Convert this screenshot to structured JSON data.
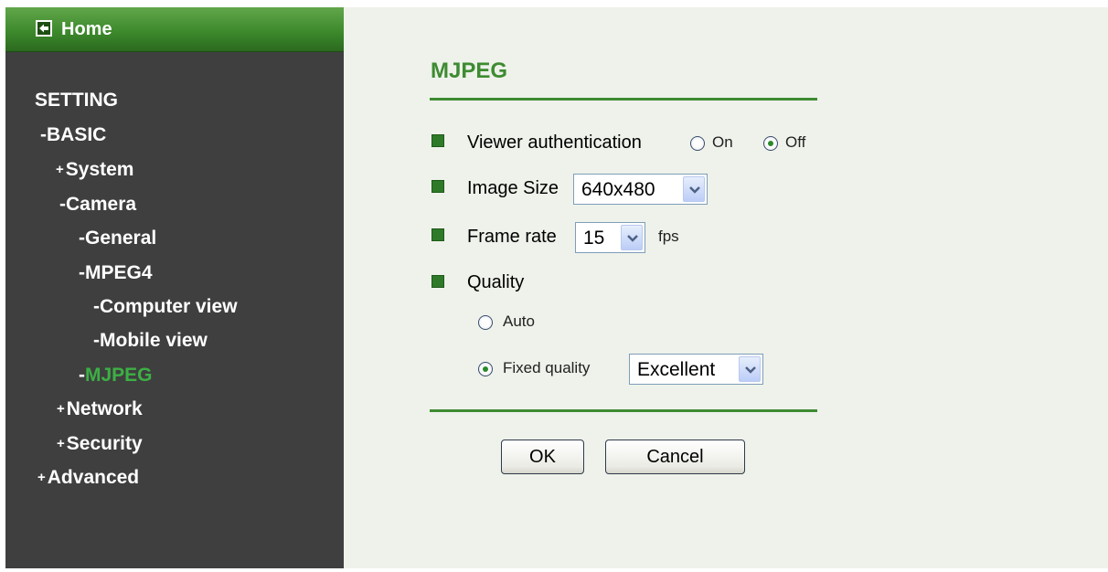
{
  "sidebar": {
    "home_label": "Home",
    "setting_label": "SETTING",
    "items": [
      {
        "prefix": "-",
        "label": "BASIC"
      },
      {
        "prefix": "+",
        "label": "System"
      },
      {
        "prefix": "-",
        "label": "Camera"
      },
      {
        "prefix": "-",
        "label": "General"
      },
      {
        "prefix": "-",
        "label": "MPEG4"
      },
      {
        "prefix": "-",
        "label": "Computer view"
      },
      {
        "prefix": "-",
        "label": "Mobile view"
      },
      {
        "prefix": "-",
        "label": "MJPEG"
      },
      {
        "prefix": "+",
        "label": "Network"
      },
      {
        "prefix": "+",
        "label": "Security"
      },
      {
        "prefix": "+",
        "label": "Advanced"
      }
    ],
    "active_item": "MJPEG"
  },
  "main": {
    "title": "MJPEG",
    "viewer_auth": {
      "label": "Viewer authentication",
      "options": [
        "On",
        "Off"
      ],
      "selected": "Off"
    },
    "image_size": {
      "label": "Image Size",
      "value": "640x480"
    },
    "frame_rate": {
      "label": "Frame rate",
      "value": "15",
      "unit": "fps"
    },
    "quality": {
      "label": "Quality",
      "auto_label": "Auto",
      "fixed_label": "Fixed quality",
      "fixed_value": "Excellent",
      "selected": "Fixed quality"
    },
    "buttons": {
      "ok": "OK",
      "cancel": "Cancel"
    }
  },
  "colors": {
    "sidebar_bg": "#3f3f3f",
    "home_bar": "#3d8a2c",
    "accent_green": "#3e8b32",
    "active_nav": "#3cb044",
    "main_bg": "#eef2ea"
  },
  "icons": {
    "home": "back-arrow-icon",
    "select_arrow": "chevron-down-icon",
    "bullet": "square-bullet-icon"
  }
}
